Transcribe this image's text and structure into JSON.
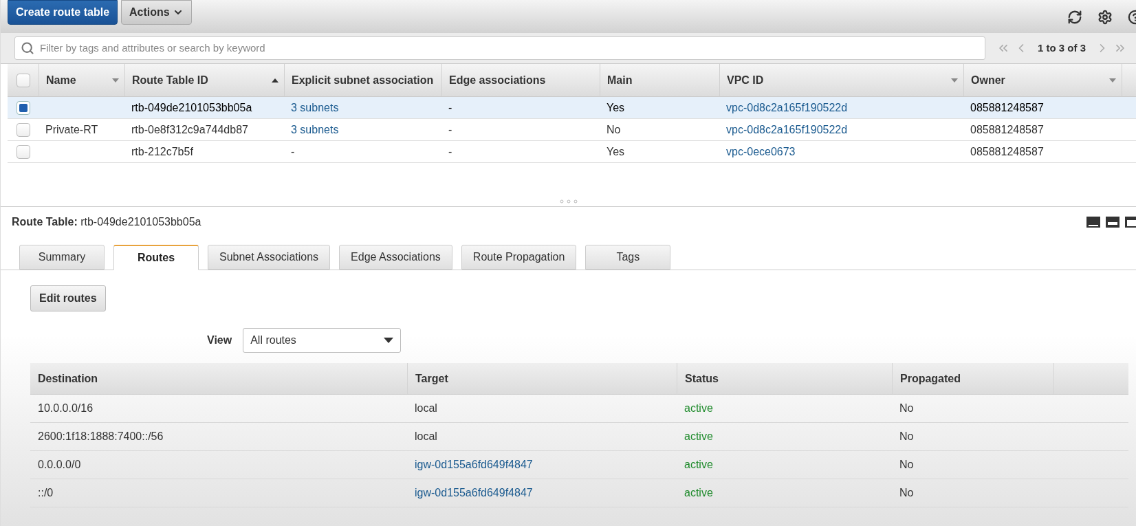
{
  "toolbar": {
    "buttons": [
      {
        "label": "Create route table",
        "kind": "primary"
      },
      {
        "label": "Actions",
        "kind": "menu"
      }
    ]
  },
  "filter": {
    "placeholder": "Filter by tags and attributes or search by keyword"
  },
  "pagination": {
    "text": "1 to 3 of 3"
  },
  "route_tables": {
    "select_all": {
      "checked": false
    },
    "columns": [
      {
        "label": "Name",
        "kind": "menu"
      },
      {
        "label": "Route Table ID",
        "kind": "sorted"
      },
      {
        "label": "Explicit subnet association",
        "kind": "plain"
      },
      {
        "label": "Edge associations",
        "kind": "plain"
      },
      {
        "label": "Main",
        "kind": "plain"
      },
      {
        "label": "VPC ID",
        "kind": "menu"
      },
      {
        "label": "Owner",
        "kind": "menu"
      }
    ],
    "rows": [
      {
        "selected": true,
        "cells": [
          null,
          {
            "text": "rtb-049de2101053bb05a",
            "kind": "text"
          },
          {
            "text": "3 subnets",
            "kind": "link"
          },
          {
            "text": "-",
            "kind": "text"
          },
          {
            "text": "Yes",
            "kind": "text"
          },
          {
            "text": "vpc-0d8c2a165f190522d",
            "kind": "link"
          },
          {
            "text": "085881248587",
            "kind": "text"
          }
        ]
      },
      {
        "selected": false,
        "cells": [
          {
            "text": "Private-RT",
            "kind": "text"
          },
          {
            "text": "rtb-0e8f312c9a744db87",
            "kind": "text"
          },
          {
            "text": "3 subnets",
            "kind": "link"
          },
          {
            "text": "-",
            "kind": "text"
          },
          {
            "text": "No",
            "kind": "text"
          },
          {
            "text": "vpc-0d8c2a165f190522d",
            "kind": "link"
          },
          {
            "text": "085881248587",
            "kind": "text"
          }
        ]
      },
      {
        "selected": false,
        "cells": [
          null,
          {
            "text": "rtb-212c7b5f",
            "kind": "text"
          },
          {
            "text": "-",
            "kind": "text"
          },
          {
            "text": "-",
            "kind": "text"
          },
          {
            "text": "Yes",
            "kind": "text"
          },
          {
            "text": "vpc-0ece0673",
            "kind": "link"
          },
          {
            "text": "085881248587",
            "kind": "text"
          }
        ]
      }
    ]
  },
  "details": {
    "label": "Route Table:",
    "value": "rtb-049de2101053bb05a"
  },
  "tabs": [
    {
      "label": "Summary",
      "selected": false
    },
    {
      "label": "Routes",
      "selected": true
    },
    {
      "label": "Subnet Associations",
      "selected": false
    },
    {
      "label": "Edge Associations",
      "selected": false
    },
    {
      "label": "Route Propagation",
      "selected": false
    },
    {
      "label": "Tags",
      "selected": false
    }
  ],
  "edit_button": {
    "label": "Edit routes"
  },
  "view": {
    "label": "View",
    "value": "All routes"
  },
  "routes": {
    "columns": [
      "Destination",
      "Target",
      "Status",
      "Propagated"
    ],
    "rows": [
      [
        {
          "text": "10.0.0.0/16",
          "kind": "text"
        },
        {
          "text": "local",
          "kind": "text"
        },
        {
          "text": "active",
          "kind": "status"
        },
        {
          "text": "No",
          "kind": "text"
        }
      ],
      [
        {
          "text": "2600:1f18:1888:7400::/56",
          "kind": "text"
        },
        {
          "text": "local",
          "kind": "text"
        },
        {
          "text": "active",
          "kind": "status"
        },
        {
          "text": "No",
          "kind": "text"
        }
      ],
      [
        {
          "text": "0.0.0.0/0",
          "kind": "text"
        },
        {
          "text": "igw-0d155a6fd649f4847",
          "kind": "link"
        },
        {
          "text": "active",
          "kind": "status"
        },
        {
          "text": "No",
          "kind": "text"
        }
      ],
      [
        {
          "text": "::/0",
          "kind": "text"
        },
        {
          "text": "igw-0d155a6fd649f4847",
          "kind": "link"
        },
        {
          "text": "active",
          "kind": "status"
        },
        {
          "text": "No",
          "kind": "text"
        }
      ]
    ]
  }
}
